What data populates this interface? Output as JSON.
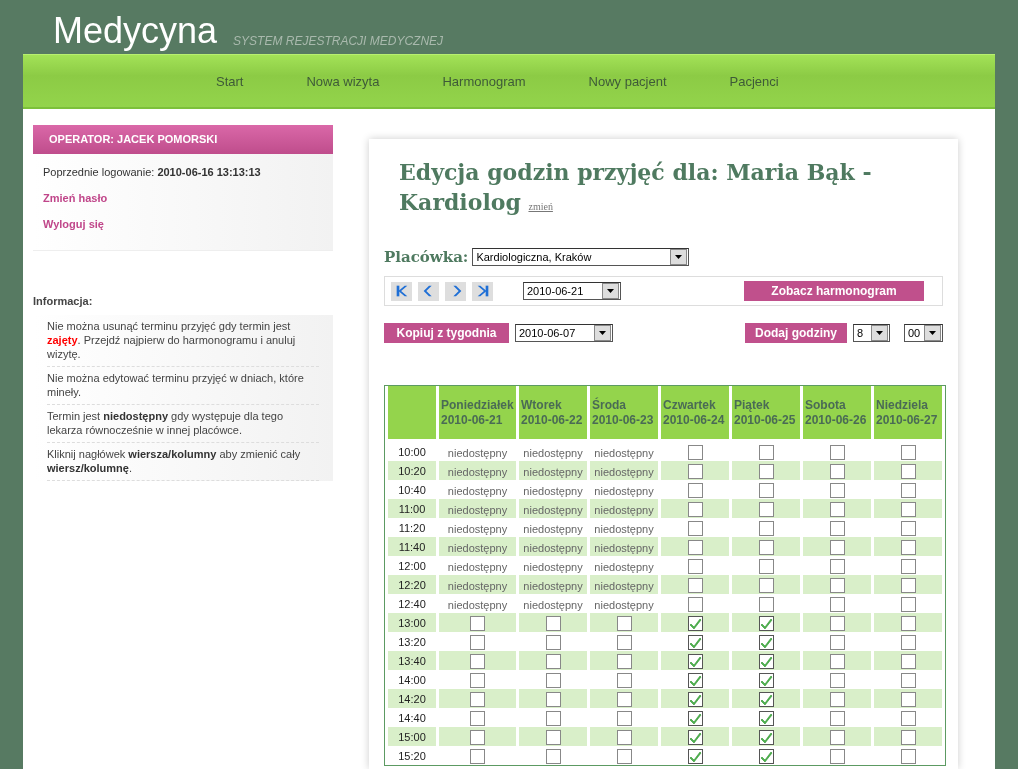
{
  "site": {
    "title": "Medycyna",
    "subtitle": "SYSTEM REJESTRACJI MEDYCZNEJ"
  },
  "nav": [
    {
      "label": "Start"
    },
    {
      "label": "Nowa wizyta"
    },
    {
      "label": "Harmonogram"
    },
    {
      "label": "Nowy pacjent"
    },
    {
      "label": "Pacjenci"
    }
  ],
  "operator": {
    "title": "OPERATOR: JACEK POMORSKI",
    "last_login_label": "Poprzednie logowanie:",
    "last_login": "2010-06-16 13:13:13",
    "links": [
      "Zmień hasło",
      "Wyloguj się"
    ]
  },
  "info": {
    "title": "Informacja:",
    "items": [
      {
        "text": "Nie można usunąć terminu przyjęć gdy termin jest **zajęty**. Przejdź najpierw do harmonogramu i anuluj wizytę.",
        "kind": "warning"
      },
      {
        "text": "Nie można edytować terminu przyjęć w dniach, które mineły.",
        "kind": "note"
      },
      {
        "text": "Termin jest **niedostępny** gdy występuje dla tego lekarza równocześnie w innej placówce.",
        "kind": "note"
      },
      {
        "text": "Kliknij nagłówek **wiersza/kolumny** aby zmienić cały **wiersz/kolumnę**.",
        "kind": "note"
      }
    ]
  },
  "main": {
    "title": "Edycja godzin przyjęć dla: Maria Bąk - Kardiolog",
    "change_link": "zmień",
    "facility_label": "Placówka:",
    "facility": "Kardiologiczna, Kraków",
    "week_date": "2010-06-21",
    "view_button": "Zobacz harmonogram",
    "copy_button": "Kopiuj z tygodnia",
    "copy_date": "2010-06-07",
    "add_button": "Dodaj godziny",
    "hour": "8",
    "minute": "00"
  },
  "table": {
    "columns": [
      {
        "day": "Poniedziałek",
        "date": "2010-06-21"
      },
      {
        "day": "Wtorek",
        "date": "2010-06-22"
      },
      {
        "day": "Środa",
        "date": "2010-06-23"
      },
      {
        "day": "Czwartek",
        "date": "2010-06-24"
      },
      {
        "day": "Piątek",
        "date": "2010-06-25"
      },
      {
        "day": "Sobota",
        "date": "2010-06-26"
      },
      {
        "day": "Niedziela",
        "date": "2010-06-27"
      }
    ],
    "rows": [
      {
        "time": "10:00",
        "cells": [
          {
            "kind": "text",
            "text": "niedostępny"
          },
          {
            "kind": "text",
            "text": "niedostępny"
          },
          {
            "kind": "text",
            "text": "niedostępny"
          },
          {
            "kind": "checkbox",
            "checked": false
          },
          {
            "kind": "checkbox",
            "checked": false
          },
          {
            "kind": "checkbox",
            "checked": false
          },
          {
            "kind": "checkbox",
            "checked": false
          }
        ]
      },
      {
        "time": "10:20",
        "cells": [
          {
            "kind": "text",
            "text": "niedostępny"
          },
          {
            "kind": "text",
            "text": "niedostępny"
          },
          {
            "kind": "text",
            "text": "niedostępny"
          },
          {
            "kind": "checkbox",
            "checked": false
          },
          {
            "kind": "checkbox",
            "checked": false
          },
          {
            "kind": "checkbox",
            "checked": false
          },
          {
            "kind": "checkbox",
            "checked": false
          }
        ]
      },
      {
        "time": "10:40",
        "cells": [
          {
            "kind": "text",
            "text": "niedostępny"
          },
          {
            "kind": "text",
            "text": "niedostępny"
          },
          {
            "kind": "text",
            "text": "niedostępny"
          },
          {
            "kind": "checkbox",
            "checked": false
          },
          {
            "kind": "checkbox",
            "checked": false
          },
          {
            "kind": "checkbox",
            "checked": false
          },
          {
            "kind": "checkbox",
            "checked": false
          }
        ]
      },
      {
        "time": "11:00",
        "cells": [
          {
            "kind": "text",
            "text": "niedostępny"
          },
          {
            "kind": "text",
            "text": "niedostępny"
          },
          {
            "kind": "text",
            "text": "niedostępny"
          },
          {
            "kind": "checkbox",
            "checked": false
          },
          {
            "kind": "checkbox",
            "checked": false
          },
          {
            "kind": "checkbox",
            "checked": false
          },
          {
            "kind": "checkbox",
            "checked": false
          }
        ]
      },
      {
        "time": "11:20",
        "cells": [
          {
            "kind": "text",
            "text": "niedostępny"
          },
          {
            "kind": "text",
            "text": "niedostępny"
          },
          {
            "kind": "text",
            "text": "niedostępny"
          },
          {
            "kind": "checkbox",
            "checked": false
          },
          {
            "kind": "checkbox",
            "checked": false
          },
          {
            "kind": "checkbox",
            "checked": false
          },
          {
            "kind": "checkbox",
            "checked": false
          }
        ]
      },
      {
        "time": "11:40",
        "cells": [
          {
            "kind": "text",
            "text": "niedostępny"
          },
          {
            "kind": "text",
            "text": "niedostępny"
          },
          {
            "kind": "text",
            "text": "niedostępny"
          },
          {
            "kind": "checkbox",
            "checked": false
          },
          {
            "kind": "checkbox",
            "checked": false
          },
          {
            "kind": "checkbox",
            "checked": false
          },
          {
            "kind": "checkbox",
            "checked": false
          }
        ]
      },
      {
        "time": "12:00",
        "cells": [
          {
            "kind": "text",
            "text": "niedostępny"
          },
          {
            "kind": "text",
            "text": "niedostępny"
          },
          {
            "kind": "text",
            "text": "niedostępny"
          },
          {
            "kind": "checkbox",
            "checked": false
          },
          {
            "kind": "checkbox",
            "checked": false
          },
          {
            "kind": "checkbox",
            "checked": false
          },
          {
            "kind": "checkbox",
            "checked": false
          }
        ]
      },
      {
        "time": "12:20",
        "cells": [
          {
            "kind": "text",
            "text": "niedostępny"
          },
          {
            "kind": "text",
            "text": "niedostępny"
          },
          {
            "kind": "text",
            "text": "niedostępny"
          },
          {
            "kind": "checkbox",
            "checked": false
          },
          {
            "kind": "checkbox",
            "checked": false
          },
          {
            "kind": "checkbox",
            "checked": false
          },
          {
            "kind": "checkbox",
            "checked": false
          }
        ]
      },
      {
        "time": "12:40",
        "cells": [
          {
            "kind": "text",
            "text": "niedostępny"
          },
          {
            "kind": "text",
            "text": "niedostępny"
          },
          {
            "kind": "text",
            "text": "niedostępny"
          },
          {
            "kind": "checkbox",
            "checked": false
          },
          {
            "kind": "checkbox",
            "checked": false
          },
          {
            "kind": "checkbox",
            "checked": false
          },
          {
            "kind": "checkbox",
            "checked": false
          }
        ]
      },
      {
        "time": "13:00",
        "cells": [
          {
            "kind": "checkbox",
            "checked": false
          },
          {
            "kind": "checkbox",
            "checked": false
          },
          {
            "kind": "checkbox",
            "checked": false
          },
          {
            "kind": "checkbox",
            "checked": true
          },
          {
            "kind": "checkbox",
            "checked": true
          },
          {
            "kind": "checkbox",
            "checked": false
          },
          {
            "kind": "checkbox",
            "checked": false
          }
        ]
      },
      {
        "time": "13:20",
        "cells": [
          {
            "kind": "checkbox",
            "checked": false
          },
          {
            "kind": "checkbox",
            "checked": false
          },
          {
            "kind": "checkbox",
            "checked": false
          },
          {
            "kind": "checkbox",
            "checked": true
          },
          {
            "kind": "checkbox",
            "checked": true
          },
          {
            "kind": "checkbox",
            "checked": false
          },
          {
            "kind": "checkbox",
            "checked": false
          }
        ]
      },
      {
        "time": "13:40",
        "cells": [
          {
            "kind": "checkbox",
            "checked": false
          },
          {
            "kind": "checkbox",
            "checked": false
          },
          {
            "kind": "checkbox",
            "checked": false
          },
          {
            "kind": "checkbox",
            "checked": true
          },
          {
            "kind": "checkbox",
            "checked": true
          },
          {
            "kind": "checkbox",
            "checked": false
          },
          {
            "kind": "checkbox",
            "checked": false
          }
        ]
      },
      {
        "time": "14:00",
        "cells": [
          {
            "kind": "checkbox",
            "checked": false
          },
          {
            "kind": "checkbox",
            "checked": false
          },
          {
            "kind": "checkbox",
            "checked": false
          },
          {
            "kind": "checkbox",
            "checked": true
          },
          {
            "kind": "checkbox",
            "checked": true
          },
          {
            "kind": "checkbox",
            "checked": false
          },
          {
            "kind": "checkbox",
            "checked": false
          }
        ]
      },
      {
        "time": "14:20",
        "cells": [
          {
            "kind": "checkbox",
            "checked": false
          },
          {
            "kind": "checkbox",
            "checked": false
          },
          {
            "kind": "checkbox",
            "checked": false
          },
          {
            "kind": "checkbox",
            "checked": true
          },
          {
            "kind": "checkbox",
            "checked": true
          },
          {
            "kind": "checkbox",
            "checked": false
          },
          {
            "kind": "checkbox",
            "checked": false
          }
        ]
      },
      {
        "time": "14:40",
        "cells": [
          {
            "kind": "checkbox",
            "checked": false
          },
          {
            "kind": "checkbox",
            "checked": false
          },
          {
            "kind": "checkbox",
            "checked": false
          },
          {
            "kind": "checkbox",
            "checked": true
          },
          {
            "kind": "checkbox",
            "checked": true
          },
          {
            "kind": "checkbox",
            "checked": false
          },
          {
            "kind": "checkbox",
            "checked": false
          }
        ]
      },
      {
        "time": "15:00",
        "cells": [
          {
            "kind": "checkbox",
            "checked": false
          },
          {
            "kind": "checkbox",
            "checked": false
          },
          {
            "kind": "checkbox",
            "checked": false
          },
          {
            "kind": "checkbox",
            "checked": true
          },
          {
            "kind": "checkbox",
            "checked": true
          },
          {
            "kind": "checkbox",
            "checked": false
          },
          {
            "kind": "checkbox",
            "checked": false
          }
        ]
      },
      {
        "time": "15:20",
        "cells": [
          {
            "kind": "checkbox",
            "checked": false
          },
          {
            "kind": "checkbox",
            "checked": false
          },
          {
            "kind": "checkbox",
            "checked": false
          },
          {
            "kind": "checkbox",
            "checked": true
          },
          {
            "kind": "checkbox",
            "checked": true
          },
          {
            "kind": "checkbox",
            "checked": false
          },
          {
            "kind": "checkbox",
            "checked": false
          }
        ]
      }
    ]
  }
}
